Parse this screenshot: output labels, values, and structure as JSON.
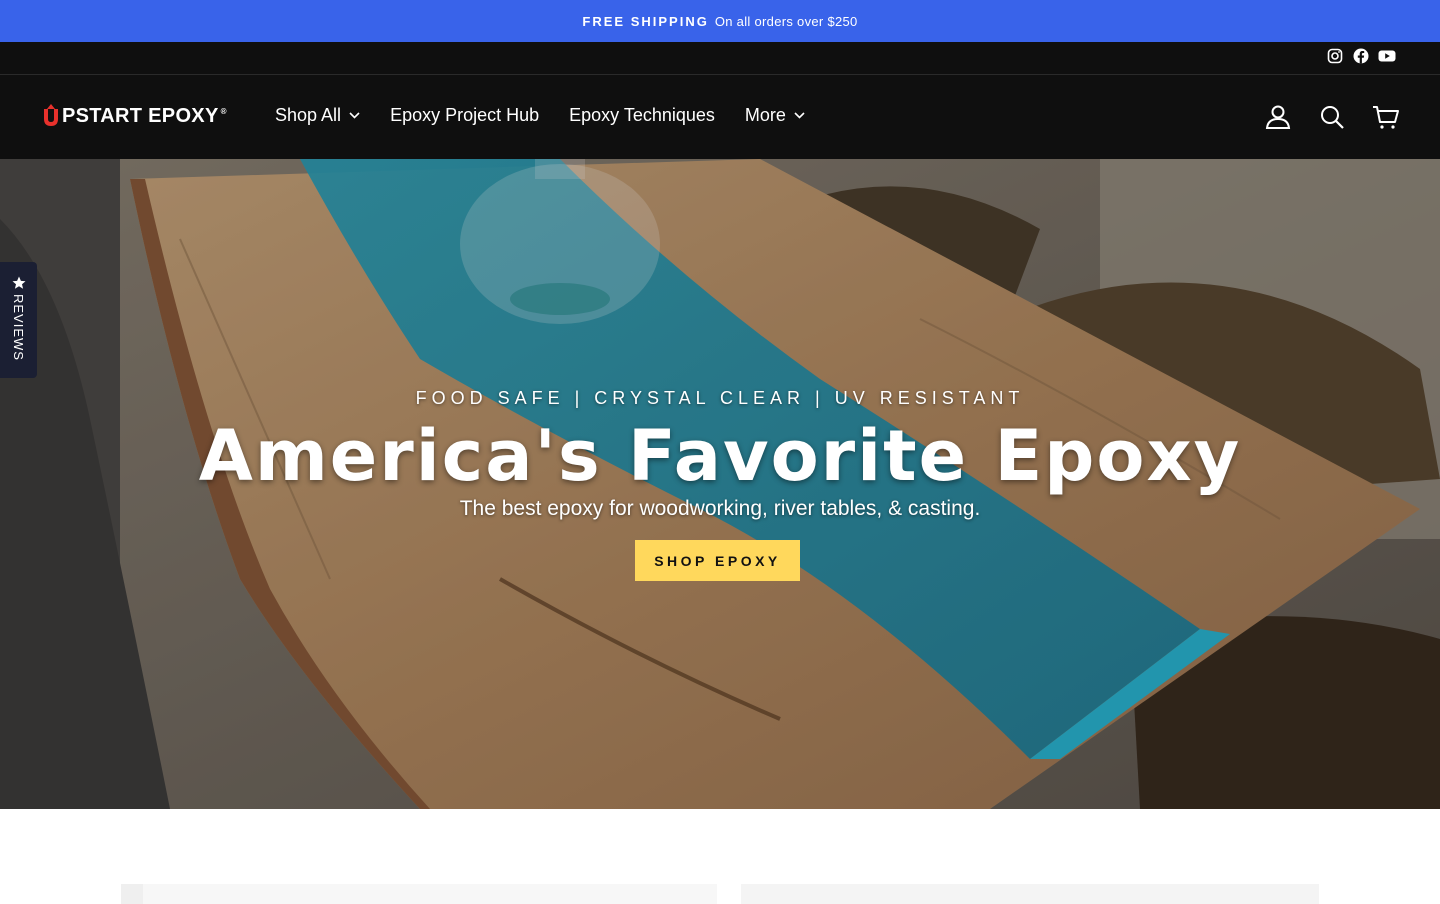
{
  "announcement": {
    "bold_text": "FREE SHIPPING",
    "text": "On all orders over $250"
  },
  "social": {
    "icons": [
      "instagram-icon",
      "facebook-icon",
      "youtube-icon"
    ]
  },
  "header": {
    "logo_text": "PSTART EPOXY",
    "logo_reg": "®",
    "nav": [
      {
        "label": "Shop All",
        "has_dropdown": true
      },
      {
        "label": "Epoxy Project Hub",
        "has_dropdown": false
      },
      {
        "label": "Epoxy Techniques",
        "has_dropdown": false
      },
      {
        "label": "More",
        "has_dropdown": true
      }
    ],
    "icons": [
      "account-icon",
      "search-icon",
      "cart-icon"
    ]
  },
  "hero": {
    "tagline": "FOOD SAFE | CRYSTAL CLEAR | UV RESISTANT",
    "headline": "America's Favorite Epoxy",
    "subhead": "The best epoxy for woodworking, river tables, & casting.",
    "cta_label": "SHOP EPOXY"
  },
  "reviews_tab": {
    "label": "REVIEWS"
  },
  "colors": {
    "announcement_bg": "#3963ea",
    "header_bg": "#0f0f0f",
    "cta_bg": "#ffd85c",
    "reviews_tab_bg": "#1b1f33",
    "logo_accent": "#e8312c"
  }
}
